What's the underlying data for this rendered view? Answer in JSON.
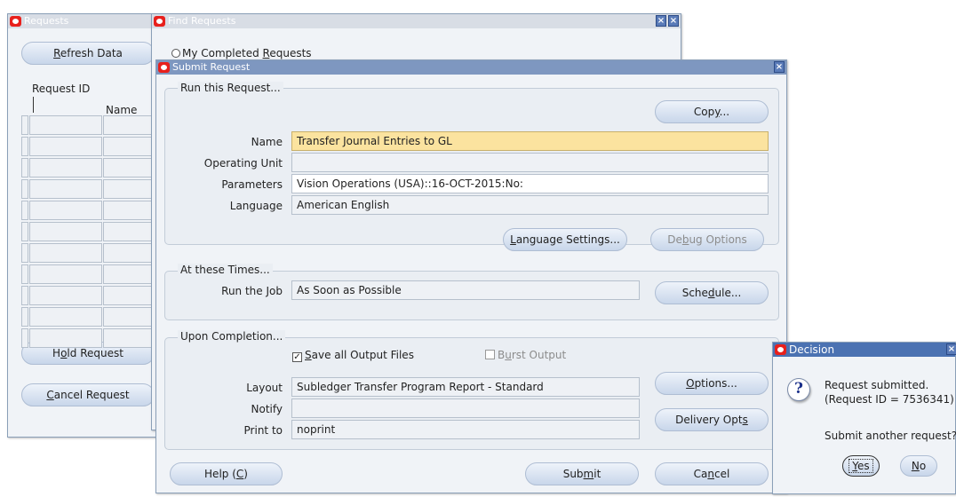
{
  "requests_window": {
    "title": "Requests",
    "refresh_label": "Refresh Data",
    "col_request_id": "Request ID",
    "col_name": "Name",
    "hold_label": "Hold Request",
    "cancel_label": "Cancel Request"
  },
  "find_window": {
    "title": "Find Requests",
    "radio_label": "My Completed Requests"
  },
  "submit_window": {
    "title": "Submit Request",
    "run_group": {
      "title": "Run this Request...",
      "copy_label": "Copy...",
      "name_label": "Name",
      "name_value": "Transfer Journal Entries to GL",
      "operating_unit_label": "Operating Unit",
      "operating_unit_value": "",
      "parameters_label": "Parameters",
      "parameters_value": "Vision Operations (USA)::16-OCT-2015:No:",
      "language_label": "Language",
      "language_value": "American English",
      "language_settings_label": "Language Settings...",
      "debug_options_label": "Debug Options"
    },
    "times_group": {
      "title": "At these Times...",
      "run_job_label": "Run the Job",
      "run_job_value": "As Soon as Possible",
      "schedule_label": "Schedule..."
    },
    "completion_group": {
      "title": "Upon Completion...",
      "save_output_label": "Save all Output Files",
      "save_output_checked": true,
      "burst_output_label": "Burst Output",
      "burst_output_checked": false,
      "layout_label": "Layout",
      "layout_value": "Subledger Transfer Program Report - Standard",
      "options_label": "Options...",
      "notify_label": "Notify",
      "notify_value": "",
      "print_to_label": "Print to",
      "print_to_value": "noprint",
      "delivery_label": "Delivery Opts"
    },
    "help_label": "Help (C)",
    "submit_label": "Submit",
    "cancel_label": "Cancel"
  },
  "decision_dialog": {
    "title": "Decision",
    "message_line1": "Request submitted.",
    "message_line2": "(Request ID = 7536341)",
    "question": "Submit another request?",
    "yes_label": "Yes",
    "no_label": "No"
  }
}
